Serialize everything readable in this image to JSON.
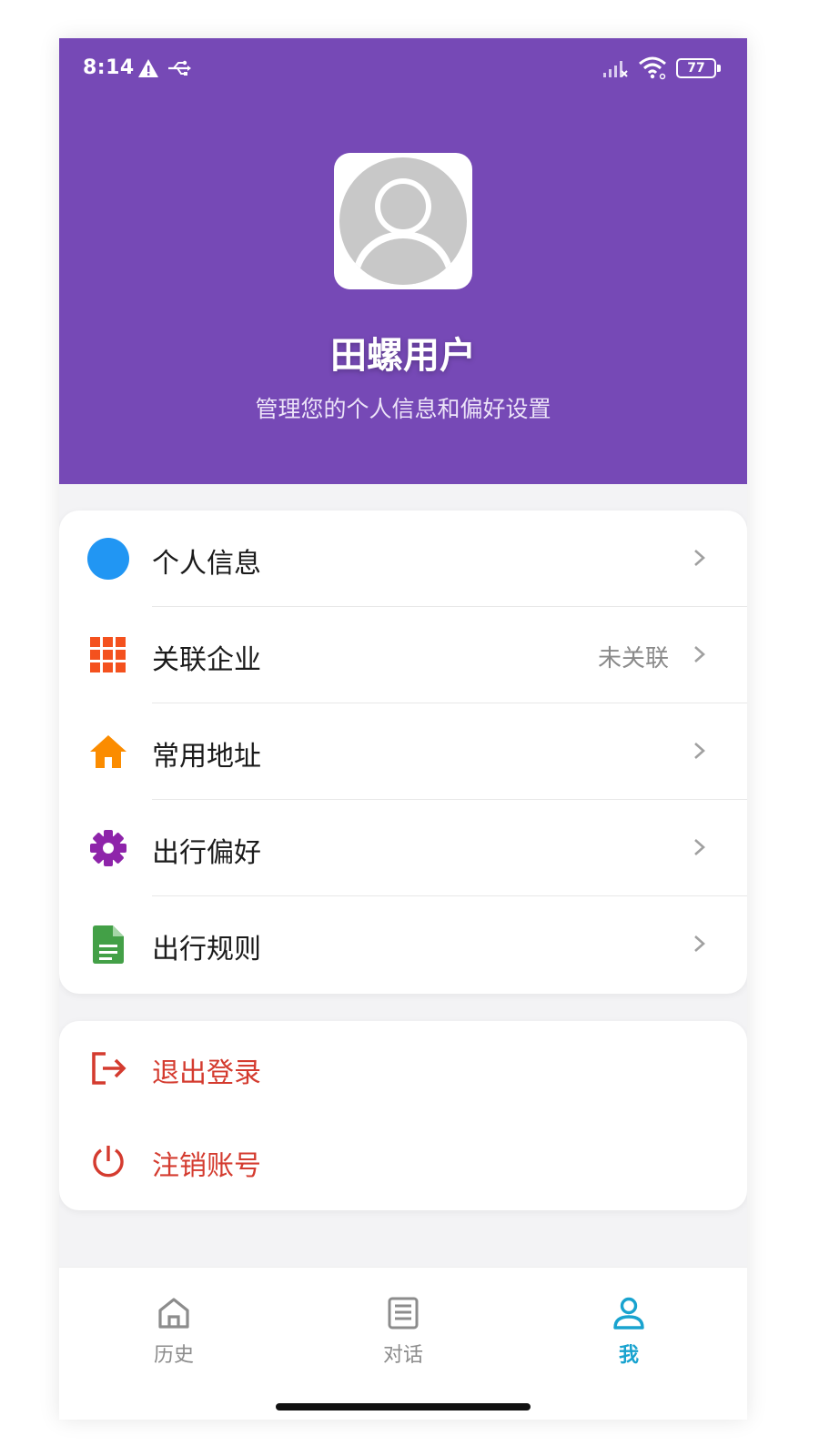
{
  "status_bar": {
    "time": "8:14",
    "battery": "77"
  },
  "profile": {
    "name": "田螺用户",
    "subtitle": "管理您的个人信息和偏好设置",
    "avatar_icon": "default-user-avatar"
  },
  "menu": {
    "items": [
      {
        "label": "个人信息",
        "value": "",
        "icon": "blue-circle-icon",
        "icon_color": "#2196f3"
      },
      {
        "label": "关联企业",
        "value": "未关联",
        "icon": "grid-icon",
        "icon_color": "#f4511e"
      },
      {
        "label": "常用地址",
        "value": "",
        "icon": "home-icon",
        "icon_color": "#fb8c00"
      },
      {
        "label": "出行偏好",
        "value": "",
        "icon": "gear-icon",
        "icon_color": "#8e24aa"
      },
      {
        "label": "出行规则",
        "value": "",
        "icon": "document-icon",
        "icon_color": "#43a047"
      }
    ]
  },
  "account": {
    "logout_label": "退出登录",
    "cancel_label": "注销账号",
    "danger_color": "#d43b2f"
  },
  "tabs": [
    {
      "label": "历史",
      "icon": "home-outline-icon"
    },
    {
      "label": "对话",
      "icon": "list-icon"
    },
    {
      "label": "我",
      "icon": "user-icon",
      "active": true
    }
  ],
  "theme": {
    "header_color": "#7649b6",
    "active_tab_color": "#19a3cf"
  }
}
